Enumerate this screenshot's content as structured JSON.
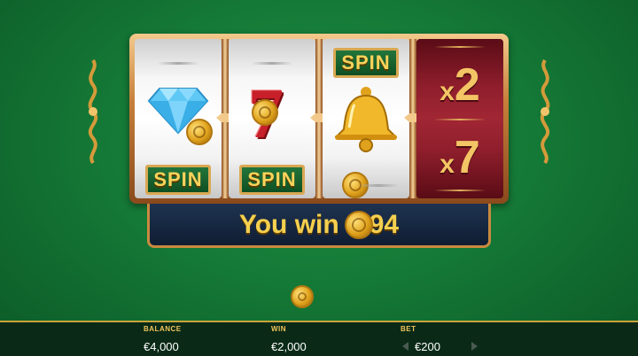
{
  "reels": {
    "reel1": {
      "bottom_tile": "SPIN",
      "top_symbol": "diamond-icon"
    },
    "reel2": {
      "bottom_tile": "SPIN",
      "top_symbol": "seven-icon",
      "seven": "7"
    },
    "reel3": {
      "top_tile": "SPIN",
      "middle_symbol": "bell-icon"
    },
    "reel4": {
      "multiplier_top_x": "x",
      "multiplier_top_n": "2",
      "multiplier_bottom_x": "x",
      "multiplier_bottom_n": "7"
    }
  },
  "win": {
    "prefix": "You win",
    "amount": "94"
  },
  "footer": {
    "balance": {
      "label": "BALANCE",
      "value": "€4,000"
    },
    "win": {
      "label": "WIN",
      "value": "€2,000"
    },
    "bet": {
      "label": "BET",
      "value": "€200"
    }
  },
  "colors": {
    "felt": "#157a37",
    "gold": "#f3c35a",
    "reel_red": "#8f1e2c",
    "win_bar": "#1e3350"
  }
}
